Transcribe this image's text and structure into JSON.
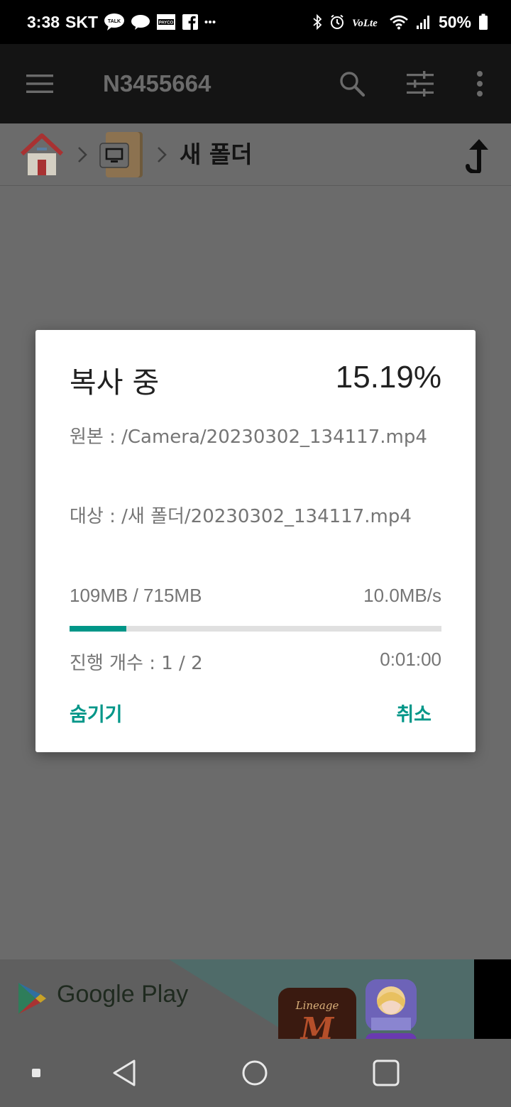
{
  "status_bar": {
    "time": "3:38",
    "carrier": "SKT",
    "talk_badge": "TALK",
    "payco_badge": "PAYCO",
    "volte": "VoLte",
    "battery": "50%"
  },
  "app_bar": {
    "title": "N3455664"
  },
  "breadcrumb": {
    "current_folder": "새 폴더"
  },
  "dialog": {
    "title": "복사 중",
    "percent": "15.19%",
    "source": "원본 : /Camera/20230302_134117.mp4",
    "target": "대상 : /새 폴더/20230302_134117.mp4",
    "size_progress": "109MB / 715MB",
    "speed": "10.0MB/s",
    "progress_fraction": 0.1519,
    "count": "진행 개수 : 1 / 2",
    "elapsed": "0:01:00",
    "hide_button": "숨기기",
    "cancel_button": "취소"
  },
  "ad": {
    "store_name": "Google Play",
    "game_logo": "Lineage",
    "game_mark": "M"
  },
  "colors": {
    "accent": "#009688",
    "app_bar": "#141414",
    "scrim": "#6b6b6b"
  }
}
